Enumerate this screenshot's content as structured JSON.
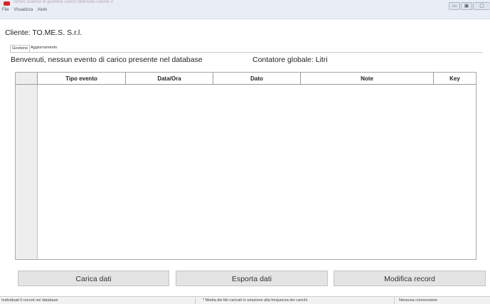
{
  "window": {
    "title": "Tomes sistema di gestione carichi Matricola Cliente 0",
    "minimize_glyph": "▭",
    "maximize_glyph": "▣",
    "close_glyph": "▢"
  },
  "menu": {
    "items": [
      "File",
      "Visualizza",
      "Aiuto"
    ]
  },
  "cliente": {
    "label": "Cliente: TO.ME.S. S.r.l."
  },
  "tabs": [
    {
      "label": "Gestione"
    },
    {
      "label": "Aggiornamento"
    }
  ],
  "info": {
    "welcome": "Benvenuti, nessun evento di carico presente nel database",
    "contatore": "Contatore globale:  Litri"
  },
  "table": {
    "columns": [
      "Tipo evento",
      "Data/Ora",
      "Dato",
      "Note",
      "Key"
    ],
    "rows": []
  },
  "buttons": {
    "carica": "Carica dati",
    "esporta": "Esporta dati",
    "modifica": "Modifica record"
  },
  "status": {
    "records": "Individuati 0 record nel database",
    "media": "* Media dei litri caricati in relazione alla frequenza dei carichi",
    "connessione": "Nessuna connessione"
  },
  "colors": {
    "app_icon": "#dd2222",
    "titlebar": "#e9eef6",
    "button_bg": "#e4e4e4",
    "row_header_bg": "#eeeeee"
  }
}
